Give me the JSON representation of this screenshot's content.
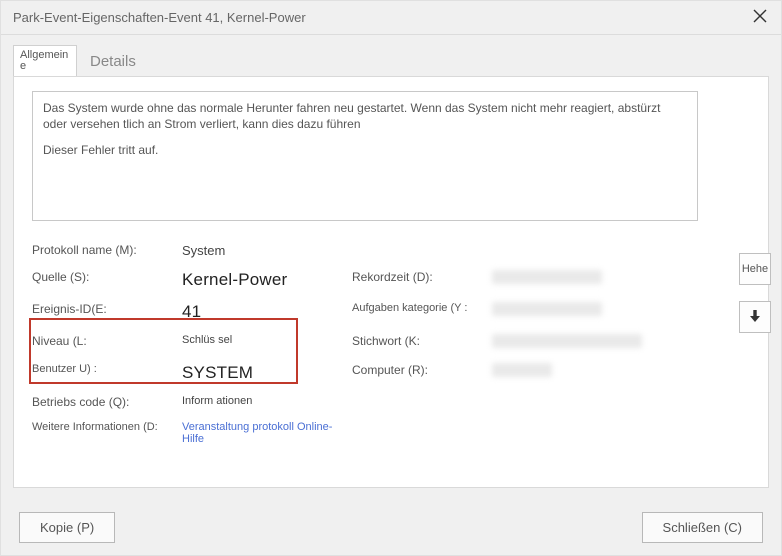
{
  "title": "Park-Event-Eigenschaften-Event 41, Kernel-Power",
  "tabs": {
    "general": "Allgemeine",
    "details": "Details"
  },
  "description": {
    "p1": "Das System wurde ohne das normale Herunter fahren neu gestartet. Wenn das System nicht mehr reagiert, abstürzt oder versehen tlich an Strom verliert, kann dies dazu führen",
    "p2": "Dieser Fehler tritt auf."
  },
  "labels": {
    "logname": "Protokoll name (M):",
    "source": "Quelle (S):",
    "eventid": "Ereignis-ID(E:",
    "level": "Niveau (L:",
    "user": "Benutzer U) :",
    "opcode": "Betriebs code (Q):",
    "moreinfo": "Weitere Informationen (D:",
    "recordtime": "Rekordzeit (D):",
    "taskcat": "Aufgaben kategorie (Y :",
    "keyword": "Stichwort (K:",
    "computer": "Computer (R):"
  },
  "values": {
    "logname": "System",
    "source": "Kernel-Power",
    "eventid": "41",
    "level": "Schlüs sel",
    "user": "SYSTEM",
    "opcode": "Inform ationen",
    "moreinfo": "Veranstaltung protokoll Online-Hilfe",
    "recordtime": " ",
    "taskcat": " ",
    "keyword": " ",
    "computer": " "
  },
  "side": {
    "hehe": "Hehe"
  },
  "footer": {
    "copy": "Kopie (P)",
    "close": "Schließen (C)"
  }
}
